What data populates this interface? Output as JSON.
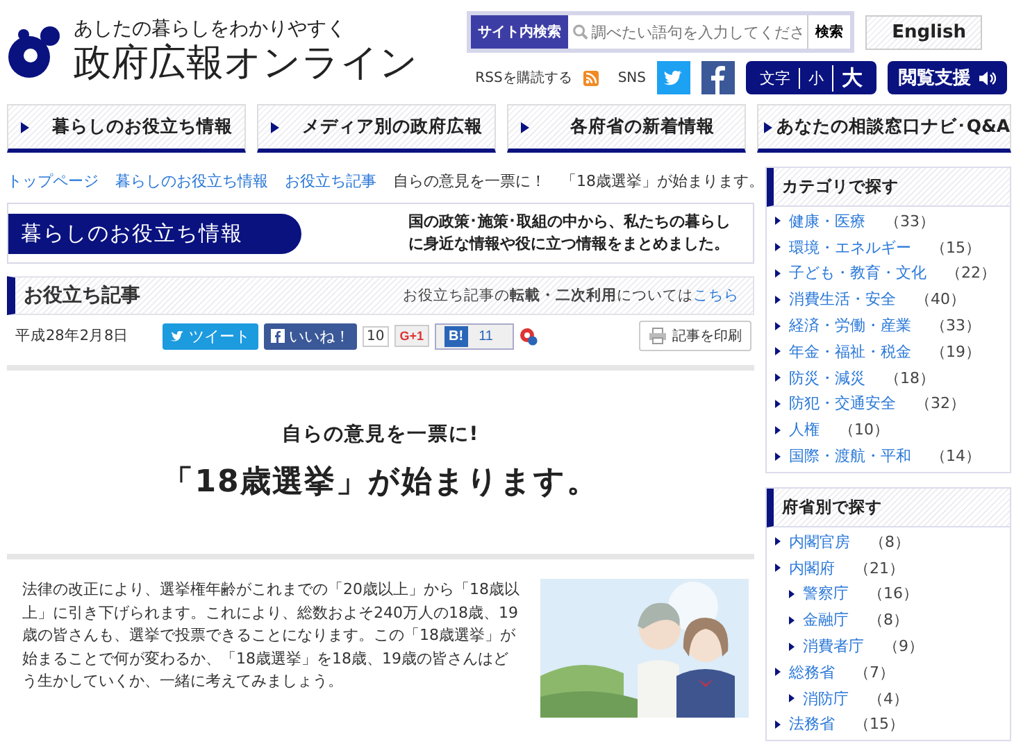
{
  "header": {
    "tagline": "あしたの暮らしをわかりやすく",
    "site_name": "政府広報オンライン",
    "search": {
      "label": "サイト内検索",
      "placeholder": "調べたい語句を入力してくださ",
      "button": "検索"
    },
    "english": "English",
    "rss": "RSSを購読する",
    "sns_label": "SNS",
    "text_size": {
      "label": "文字",
      "small": "小",
      "large": "大"
    },
    "accessibility": "閲覧支援"
  },
  "nav": [
    {
      "label": "暮らしのお役立ち情報"
    },
    {
      "label": "メディア別の政府広報"
    },
    {
      "label": "各府省の新着情報"
    },
    {
      "label": "あなたの相談窓口ナビ･Q&A"
    }
  ],
  "breadcrumb": [
    {
      "text": "トップページ",
      "kind": "link"
    },
    {
      "text": "暮らしのお役立ち情報",
      "kind": "link"
    },
    {
      "text": "お役立ち記事",
      "kind": "link"
    },
    {
      "text": "自らの意見を一票に！　「18歳選挙」が始まります。",
      "kind": "current"
    }
  ],
  "banner": {
    "title": "暮らしのお役立ち情報",
    "description": "国の政策･施策･取組の中から、私たちの暮らしに身近な情報や役に立つ情報をまとめました。"
  },
  "section": {
    "title": "お役立ち記事",
    "note": "お役立ち記事の**転載・二次利用**については",
    "note_link": "こちら"
  },
  "meta": {
    "date": "平成28年2月8日",
    "tweet": "ツイート",
    "like": "いいね！",
    "like_count": "10",
    "gplus": "G+1",
    "hatena": "B!",
    "hatena_count": "11",
    "print": "記事を印刷"
  },
  "article": {
    "subtitle": "自らの意見を一票に!",
    "title": "「18歳選挙」が始まります。",
    "body": "法律の改正により、選挙権年齢がこれまでの「20歳以上」から「18歳以上」に引き下げられます。これにより、総数およそ240万人の18歳、19歳の皆さんも、選挙で投票できることになります。この「18歳選挙」が始まることで何が変わるか、「18歳選挙」を18歳、19歳の皆さんはどう生かしていくか、一緒に考えてみましょう。"
  },
  "sidebar": [
    {
      "title": "カテゴリで探す",
      "items": [
        {
          "label": "健康・医療",
          "count": "（33）"
        },
        {
          "label": "環境・エネルギー",
          "count": "（15）"
        },
        {
          "label": "子ども・教育・文化",
          "count": "（22）"
        },
        {
          "label": "消費生活・安全",
          "count": "（40）"
        },
        {
          "label": "経済・労働・産業",
          "count": "（33）"
        },
        {
          "label": "年金・福祉・税金",
          "count": "（19）"
        },
        {
          "label": "防災・減災",
          "count": "（18）"
        },
        {
          "label": "防犯・交通安全",
          "count": "（32）"
        },
        {
          "label": "人権",
          "count": "（10）"
        },
        {
          "label": "国際・渡航・平和",
          "count": "（14）"
        }
      ]
    },
    {
      "title": "府省別で探す",
      "items": [
        {
          "label": "内閣官房",
          "count": "（8）"
        },
        {
          "label": "内閣府",
          "count": "（21）",
          "children": [
            {
              "label": "警察庁",
              "count": "（16）"
            },
            {
              "label": "金融庁",
              "count": "（8）"
            },
            {
              "label": "消費者庁",
              "count": "（9）"
            }
          ]
        },
        {
          "label": "総務省",
          "count": "（7）",
          "children": [
            {
              "label": "消防庁",
              "count": "（4）"
            }
          ]
        },
        {
          "label": "法務省",
          "count": "（15）"
        }
      ]
    }
  ]
}
